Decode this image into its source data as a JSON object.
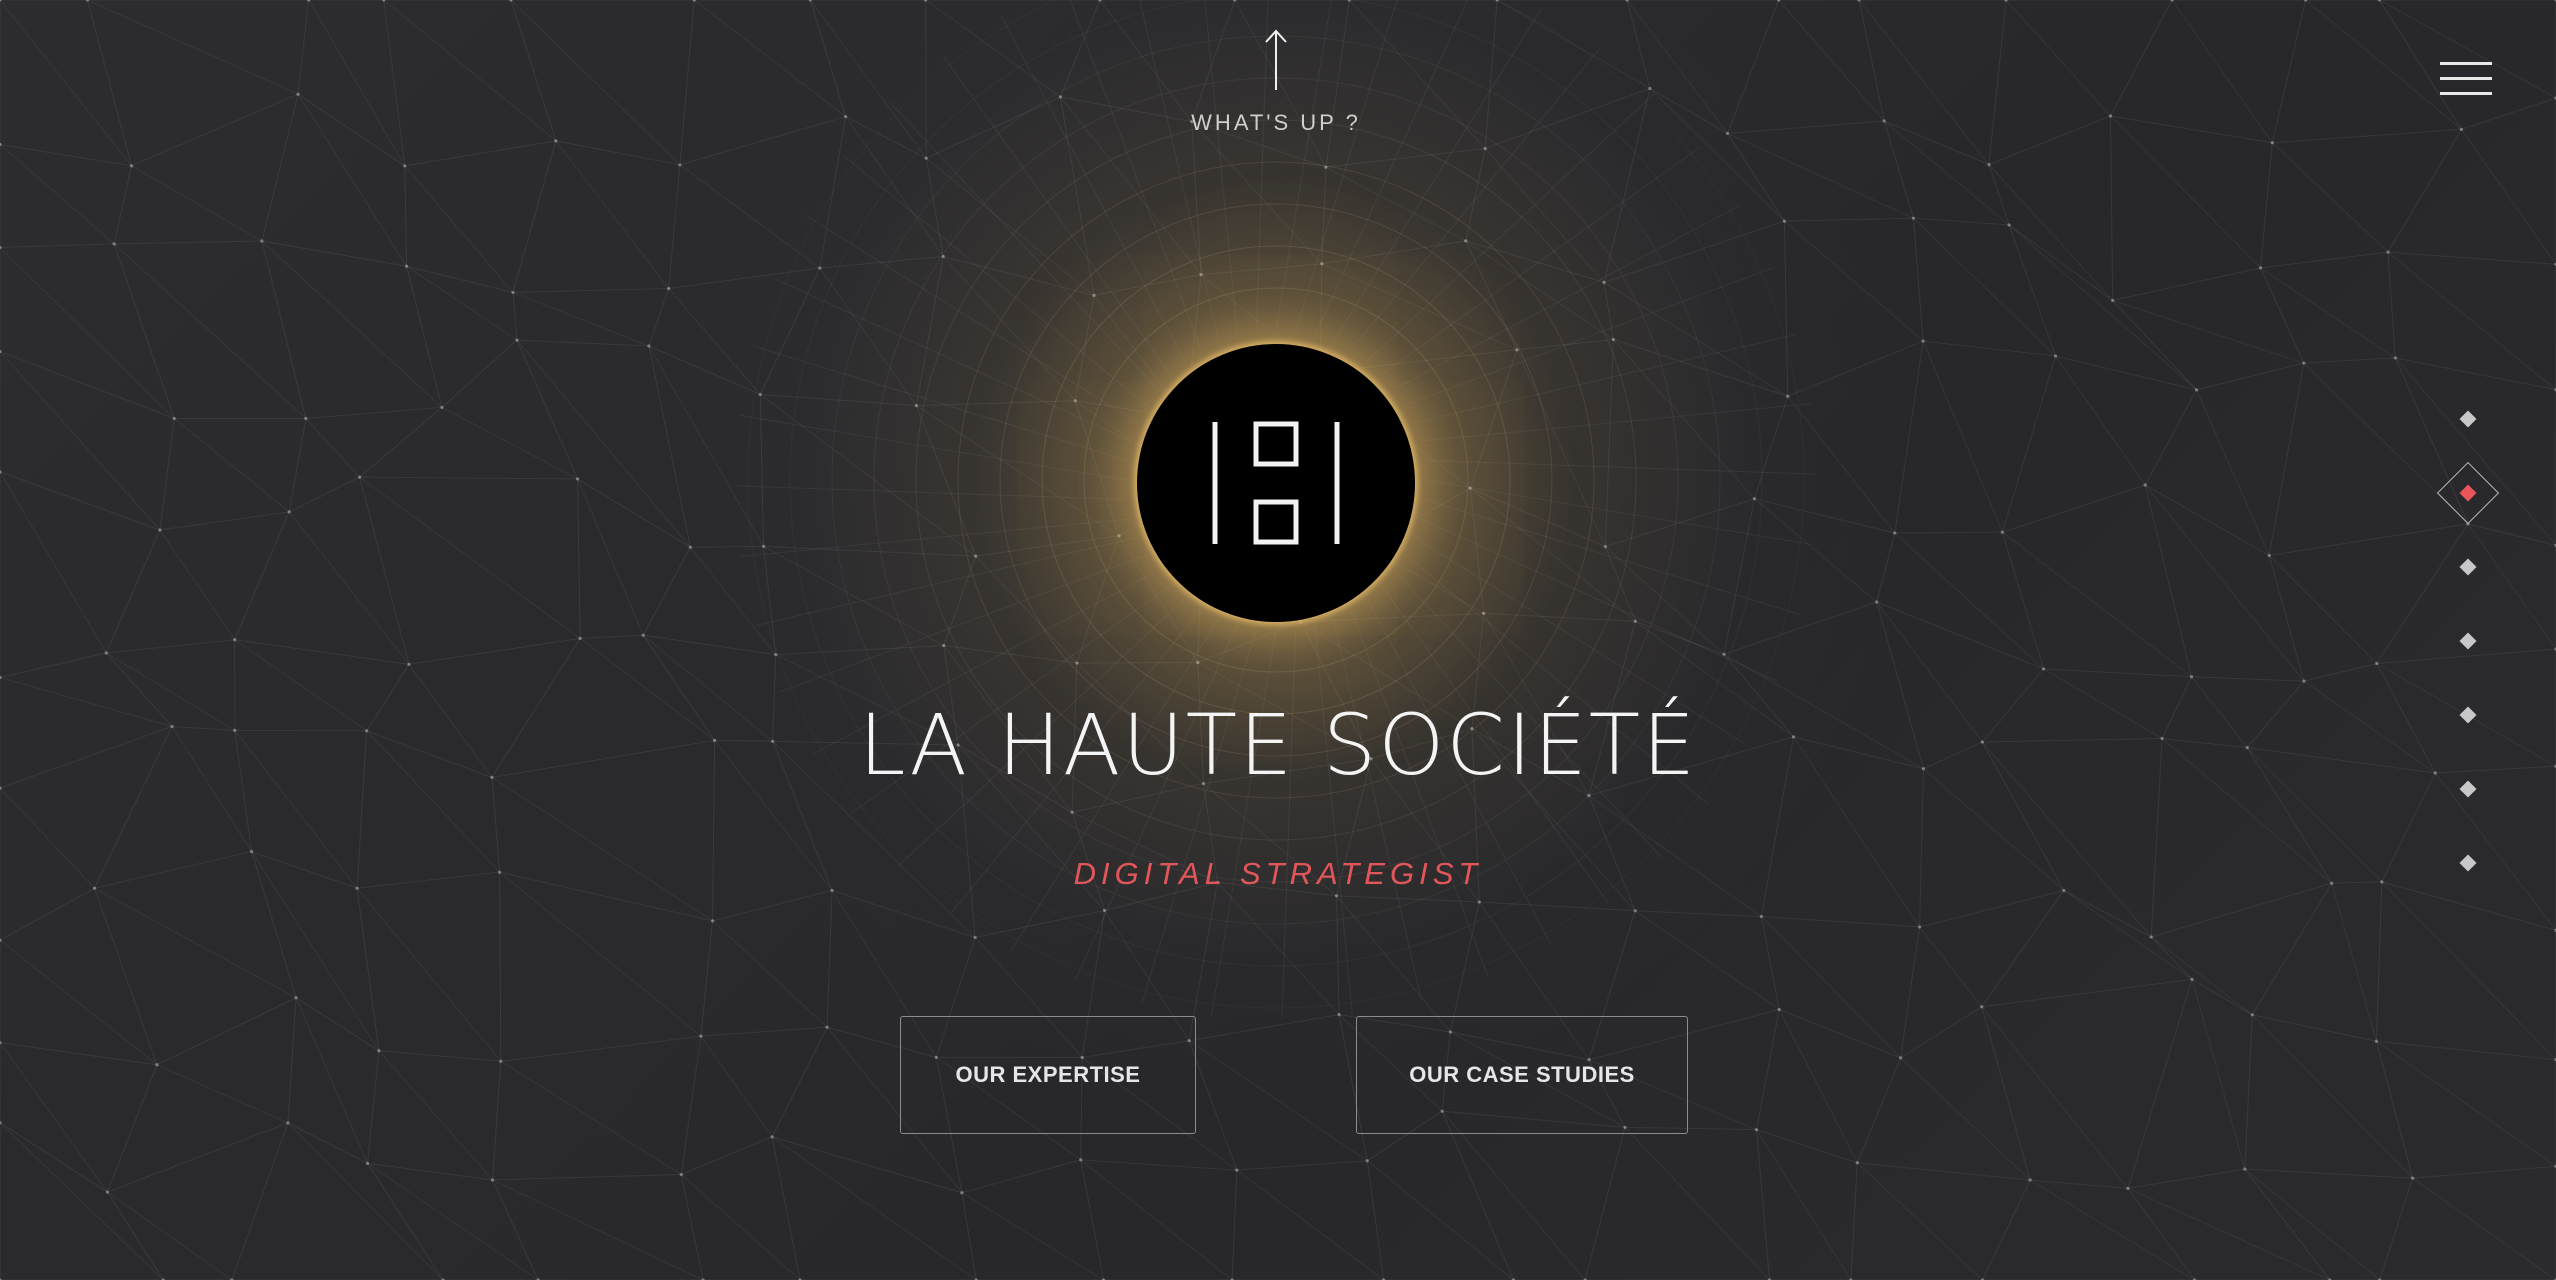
{
  "header": {
    "scroll_up_label": "WHAT'S UP ?",
    "scroll_up_icon": "arrow-up-icon",
    "menu_icon": "hamburger-menu-icon"
  },
  "hero": {
    "logo_icon": "la-haute-societe-logo",
    "title": "LA HAUTE SOCIÉTÉ",
    "subtitle": "DIGITAL STRATEGIST",
    "buttons": {
      "expertise": "OUR EXPERTISE",
      "case_studies": "OUR CASE STUDIES"
    }
  },
  "side_nav": {
    "count": 7,
    "active_index": 1
  },
  "colors": {
    "background": "#2a2a2e",
    "accent": "#e0565a",
    "glow": "#c8a864",
    "text": "#f4f4f4"
  }
}
